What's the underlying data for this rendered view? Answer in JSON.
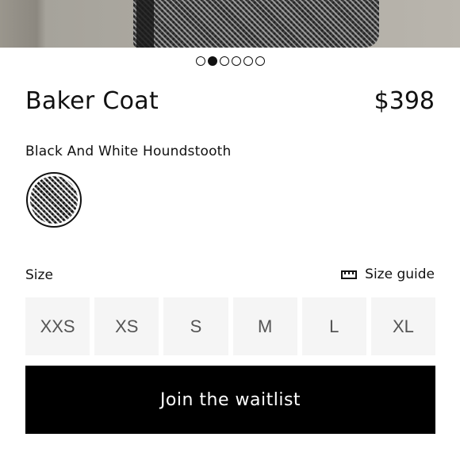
{
  "gallery": {
    "image_count": 6,
    "active_index": 1
  },
  "product": {
    "name": "Baker Coat",
    "price": "$398"
  },
  "color": {
    "name": "Black And White Houndstooth",
    "swatch_icon": "houndstooth-swatch"
  },
  "size": {
    "label": "Size",
    "guide_label": "Size guide",
    "guide_icon": "ruler-icon",
    "options": [
      "XXS",
      "XS",
      "S",
      "M",
      "L",
      "XL"
    ]
  },
  "cta": {
    "label": "Join the waitlist"
  },
  "colors": {
    "primary": "#000000",
    "size_bg": "#f5f5f5",
    "size_text": "#555555"
  }
}
